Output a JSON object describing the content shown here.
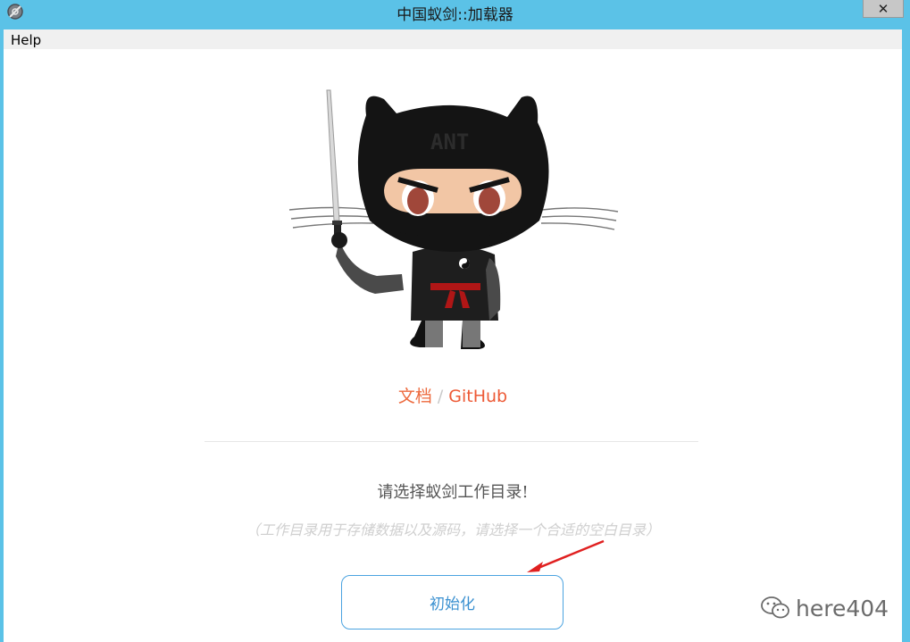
{
  "window": {
    "title": "中国蚁剑::加载器",
    "close_glyph": "✕"
  },
  "menubar": {
    "items": [
      {
        "label": "Help"
      }
    ]
  },
  "main": {
    "mascot_icon": "octocat-ninja-icon",
    "mascot_headband_text": "ANT",
    "links": {
      "docs_label": "文档",
      "separator": "/",
      "github_label": "GitHub"
    },
    "prompt": "请选择蚁剑工作目录!",
    "hint": "（工作目录用于存储数据以及源码，请选择一个合适的空白目录）",
    "init_button_label": "初始化"
  },
  "watermark": {
    "icon": "wechat-icon",
    "text": "here404"
  },
  "colors": {
    "titlebar": "#5bc2e7",
    "link": "#ed5a36",
    "button_border": "#4ba3e0",
    "arrow": "#e02020"
  }
}
